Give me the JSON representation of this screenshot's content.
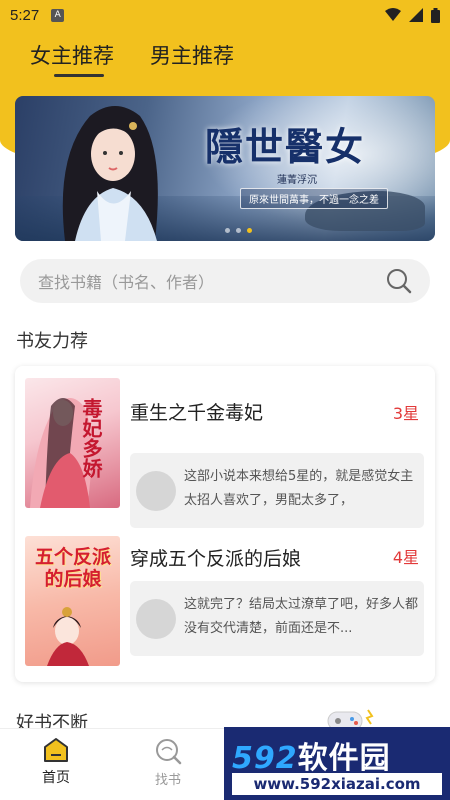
{
  "status_bar": {
    "time": "5:27",
    "badge": "A"
  },
  "tabs": [
    {
      "label": "女主推荐",
      "active": true
    },
    {
      "label": "男主推荐",
      "active": false
    }
  ],
  "banner": {
    "title": "隱世醫女",
    "author": "蓮菁浮沉",
    "tagline": "原來世間萬事，不過一念之差",
    "dots": 3,
    "active_dot": 2
  },
  "search": {
    "placeholder": "查找书籍（书名、作者）"
  },
  "section_recommend": "书友力荐",
  "books": [
    {
      "title": "重生之千金毒妃",
      "rating": "3星",
      "cover_text": "毒妃多娇",
      "comment": "这部小说本来想给5星的，就是感觉女主太招人喜欢了，男配太多了，"
    },
    {
      "title": "穿成五个反派的后娘",
      "rating": "4星",
      "cover_text": "五个反派的后娘",
      "comment": "这就完了？结局太过潦草了吧，好多人都没有交代清楚，前面还是不..."
    }
  ],
  "section_more": "好书不断",
  "bottom_nav": [
    {
      "label": "首页",
      "active": true
    },
    {
      "label": "找书",
      "active": false
    }
  ],
  "watermark": {
    "main_num": "592",
    "main_text": "软件园",
    "url": "www.592xiazai.com"
  },
  "colors": {
    "accent": "#f2c11e",
    "rating": "#e23a3a"
  }
}
